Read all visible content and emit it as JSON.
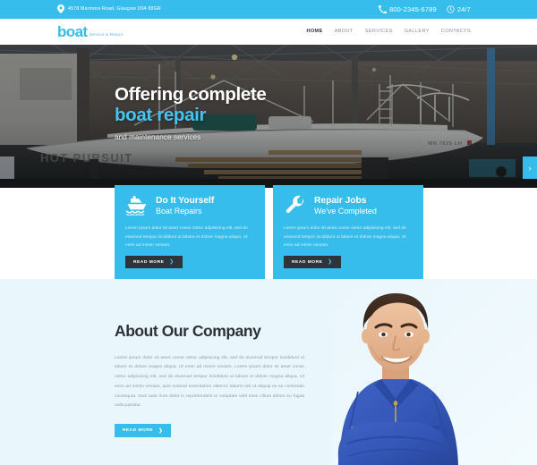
{
  "topbar": {
    "address": "4578 Marmora Road, Glasgow D04 89GR",
    "phone": "800-2345-6789",
    "hours": "24/7",
    "bg_color": "#36bdec"
  },
  "header": {
    "logo_main": "boat",
    "logo_sub": "Service & Repair",
    "nav": [
      {
        "label": "HOME",
        "active": true
      },
      {
        "label": "ABOUT",
        "active": false
      },
      {
        "label": "SERVICES",
        "active": false
      },
      {
        "label": "GALLERY",
        "active": false
      },
      {
        "label": "CONTACTS",
        "active": false
      }
    ]
  },
  "hero": {
    "line1": "Offering complete",
    "line2": "boat repair",
    "line3": "and maintenance services",
    "accent_color": "#44c3f0",
    "boat_name": "HOT PURSUIT",
    "boat_registration": "WN 7625 LH",
    "prev_arrow": "‹",
    "next_arrow": "›"
  },
  "cards": [
    {
      "icon": "boat-icon",
      "title_line1": "Do It Yourself",
      "title_line2": "Boat Repairs",
      "body": "Lorem ipsum dolor sit amet conse ctetur adipisicing elit, sed do eiusmod tempor incididunt ut labore et dolore magna aliqua. Ut enim ad minim veniam.",
      "button_label": "READ MORE",
      "button_arrow": "❯"
    },
    {
      "icon": "wrench-icon",
      "title_line1": "Repair Jobs",
      "title_line2": "We've Completed",
      "body": "Lorem ipsum dolor sit amet conse ctetur adipisicing elit, sed do eiusmod tempor incididunt ut labore et dolore magna aliqua. Ut enim ad minim veniam.",
      "button_label": "READ MORE",
      "button_arrow": "❯"
    }
  ],
  "about": {
    "title": "About Our Company",
    "body": "Lorem ipsum dolor sit amet conse ctetur adipisicing elit, sed do eiusmod tempor incididunt ut labore et dolore magna aliqua. Ut enim ad minim veniam. Lorem ipsum dolor sit amet conse ctetur adipisicing elit, sed do eiusmod tempor incididunt ut labore et dolore magna aliqua. Ut enim ad minim veniam, quis nostrud exercitation ullamco laboris nisi ut aliquip ex ea commodo consequat. Duis aute irure dolor in reprehenderit in voluptate velit esse cillum dolore eu fugiat nulla pariatur.",
    "button_label": "READ MORE",
    "button_arrow": "❯",
    "bg_color": "#e9f6fc"
  }
}
